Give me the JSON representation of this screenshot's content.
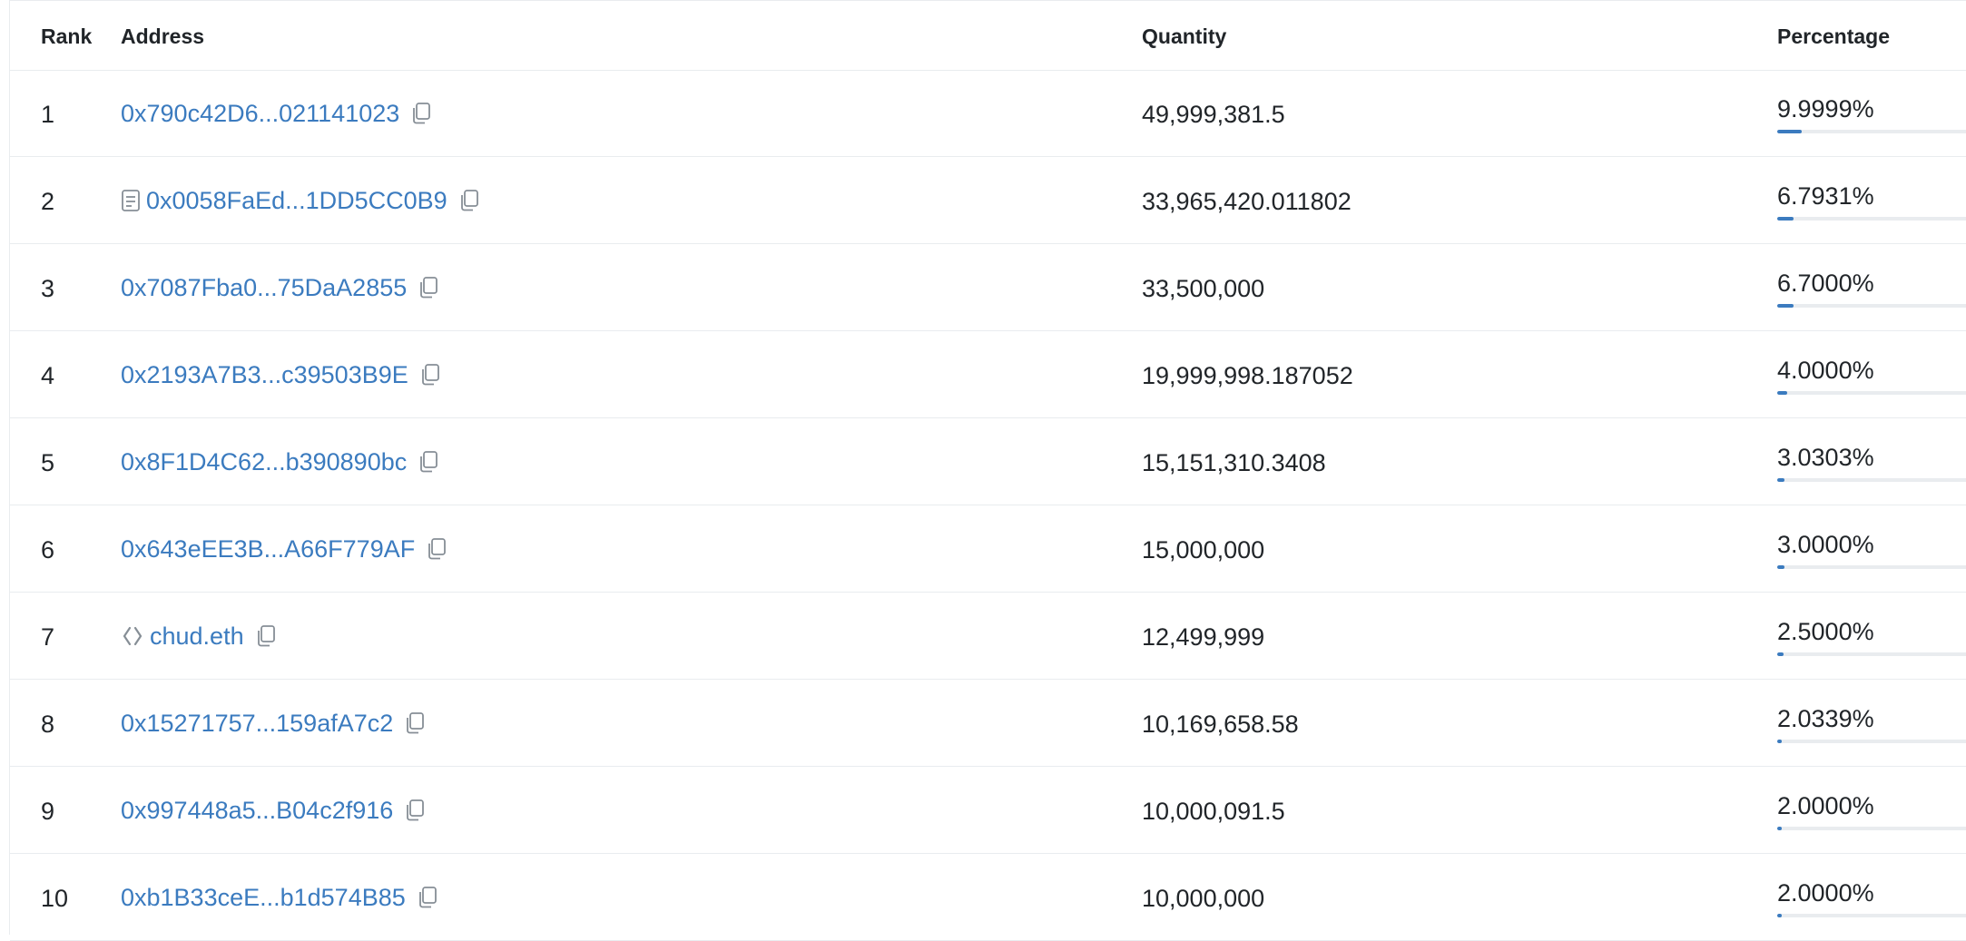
{
  "table": {
    "headers": {
      "rank": "Rank",
      "address": "Address",
      "quantity": "Quantity",
      "percentage": "Percentage"
    },
    "rows": [
      {
        "rank": "1",
        "address": "0x790c42D6...021141023",
        "address_icon": null,
        "quantity": "49,999,381.5",
        "percentage": "9.9999%",
        "percentage_value": 9.9999
      },
      {
        "rank": "2",
        "address": "0x0058FaEd...1DD5CC0B9",
        "address_icon": "contract-document-icon",
        "quantity": "33,965,420.011802",
        "percentage": "6.7931%",
        "percentage_value": 6.7931
      },
      {
        "rank": "3",
        "address": "0x7087Fba0...75DaA2855",
        "address_icon": null,
        "quantity": "33,500,000",
        "percentage": "6.7000%",
        "percentage_value": 6.7
      },
      {
        "rank": "4",
        "address": "0x2193A7B3...c39503B9E",
        "address_icon": null,
        "quantity": "19,999,998.187052",
        "percentage": "4.0000%",
        "percentage_value": 4.0
      },
      {
        "rank": "5",
        "address": "0x8F1D4C62...b390890bc",
        "address_icon": null,
        "quantity": "15,151,310.3408",
        "percentage": "3.0303%",
        "percentage_value": 3.0303
      },
      {
        "rank": "6",
        "address": "0x643eEE3B...A66F779AF",
        "address_icon": null,
        "quantity": "15,000,000",
        "percentage": "3.0000%",
        "percentage_value": 3.0
      },
      {
        "rank": "7",
        "address": "chud.eth",
        "address_icon": "ens-name-icon",
        "quantity": "12,499,999",
        "percentage": "2.5000%",
        "percentage_value": 2.5
      },
      {
        "rank": "8",
        "address": "0x15271757...159afA7c2",
        "address_icon": null,
        "quantity": "10,169,658.58",
        "percentage": "2.0339%",
        "percentage_value": 2.0339
      },
      {
        "rank": "9",
        "address": "0x997448a5...B04c2f916",
        "address_icon": null,
        "quantity": "10,000,091.5",
        "percentage": "2.0000%",
        "percentage_value": 2.0
      },
      {
        "rank": "10",
        "address": "0xb1B33ceE...b1d574B85",
        "address_icon": null,
        "quantity": "10,000,000",
        "percentage": "2.0000%",
        "percentage_value": 2.0
      }
    ]
  },
  "colors": {
    "link": "#3b7bbf",
    "bar_fill": "#3b7bbf",
    "bar_track": "#e9ecef",
    "row_border": "#e9ecef",
    "icon_gray": "#868e96"
  },
  "progress_bar_max_percent": 100
}
